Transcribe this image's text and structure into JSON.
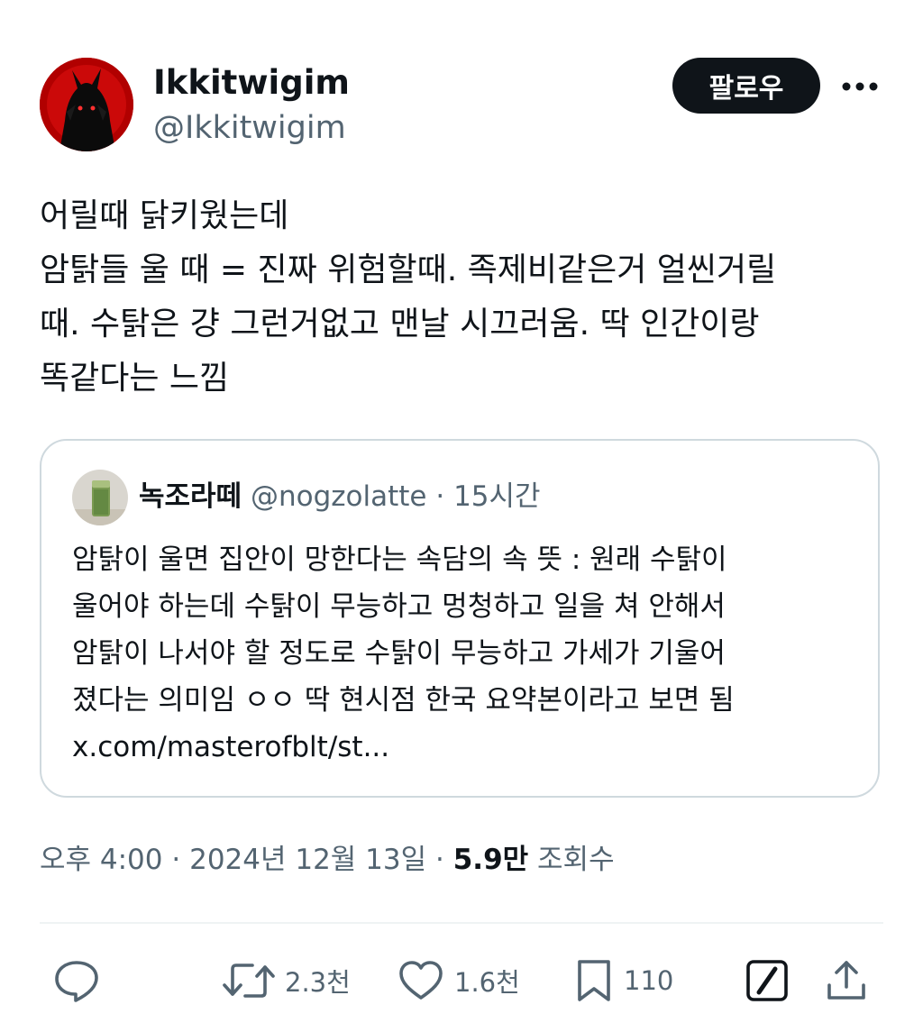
{
  "author": {
    "display_name": "Ikkitwigim",
    "handle": "@Ikkitwigim"
  },
  "follow_label": "팔로우",
  "tweet_lines": [
    "어릴때 닭키웠는데",
    "암탉들 울 때 = 진짜 위험할때. 족제비같은거 얼씬거릴",
    "때. 수탉은 걍 그런거없고 맨날 시끄러움. 딱 인간이랑",
    "똑같다는 느낌"
  ],
  "quote": {
    "display_name": "녹조라떼",
    "handle": "@nogzolatte",
    "separator": "·",
    "time": "15시간",
    "lines": [
      "암탉이 울면 집안이 망한다는 속담의 속 뜻 : 원래 수탉이",
      "울어야 하는데 수탉이 무능하고 멍청하고 일을 쳐 안해서",
      "암탉이 나서야 할 정도로 수탉이 무능하고 가세가 기울어",
      "졌다는 의미임 ㅇㅇ 딱 현시점 한국 요약본이라고 보면 됨",
      "x.com/masterofblt/st..."
    ]
  },
  "meta": {
    "time": "오후 4:00",
    "separator": "·",
    "date": "2024년 12월 13일",
    "views_count": "5.9만",
    "views_label": "조회수"
  },
  "actions": {
    "retweets": "2.3천",
    "likes": "1.6천",
    "bookmarks": "110"
  },
  "colors": {
    "text_primary": "#0f1419",
    "text_secondary": "#536471",
    "border": "#cfd9de",
    "follow_bg": "#0f1419",
    "avatar_bg": "#b10000"
  },
  "icons": [
    "reply-icon",
    "retweet-icon",
    "like-icon",
    "bookmark-icon",
    "grok-icon",
    "share-icon",
    "more-icon"
  ]
}
